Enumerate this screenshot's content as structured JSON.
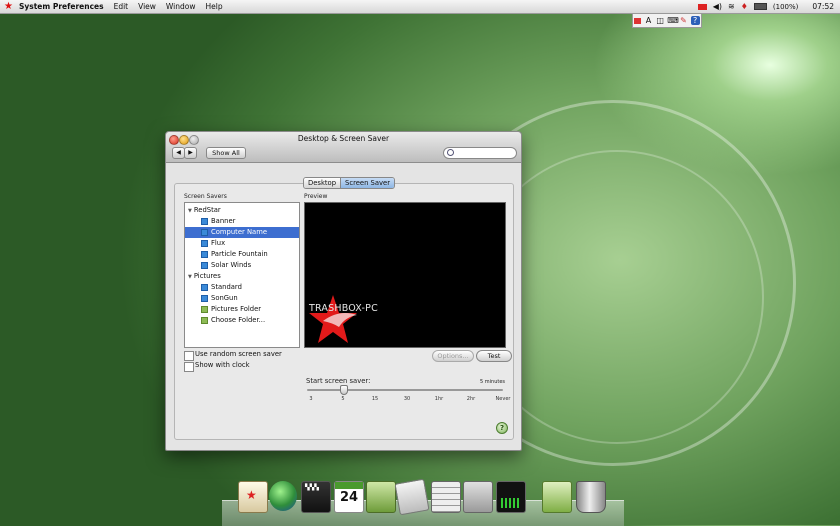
{
  "menubar": {
    "app_name": "System Preferences",
    "menus": [
      "Edit",
      "View",
      "Window",
      "Help"
    ],
    "battery_text": "(100%)",
    "clock": "07:52"
  },
  "window": {
    "title": "Desktop & Screen Saver",
    "show_all_label": "Show All",
    "search_placeholder": "",
    "tabs": [
      {
        "label": "Desktop",
        "selected": false
      },
      {
        "label": "Screen Saver",
        "selected": true
      }
    ],
    "screen_savers_label": "Screen Savers",
    "preview_label": "Preview",
    "groups": [
      {
        "label": "RedStar",
        "items": [
          {
            "label": "Banner",
            "selected": false
          },
          {
            "label": "Computer Name",
            "selected": true
          },
          {
            "label": "Flux",
            "selected": false
          },
          {
            "label": "Particle Fountain",
            "selected": false
          },
          {
            "label": "Solar Winds",
            "selected": false
          }
        ]
      },
      {
        "label": "Pictures",
        "items": [
          {
            "label": "Standard",
            "selected": false
          },
          {
            "label": "SonGun",
            "selected": false
          },
          {
            "label": "Pictures Folder",
            "selected": false
          },
          {
            "label": "Choose Folder...",
            "selected": false
          }
        ]
      }
    ],
    "preview_computer_name": "TRASHBOX-PC",
    "options_label": "Options...",
    "test_label": "Test",
    "random_label": "Use random screen saver",
    "clock_label": "Show with clock",
    "start_label": "Start screen saver:",
    "start_value": "5 minutes",
    "slider_ticks": [
      "3",
      "5",
      "15",
      "30",
      "1hr",
      "2hr",
      "Never"
    ],
    "slider_position_fraction": 0.17,
    "help_label": "?"
  },
  "dock": {
    "icons": [
      "photo-viewer-icon",
      "web-browser-icon",
      "movie-icon",
      "calendar-icon",
      "address-book-icon",
      "preview-icon",
      "calculator-icon",
      "system-preferences-icon",
      "activity-monitor-icon",
      "downloads-icon",
      "trash-icon"
    ],
    "calendar_day": "24"
  }
}
